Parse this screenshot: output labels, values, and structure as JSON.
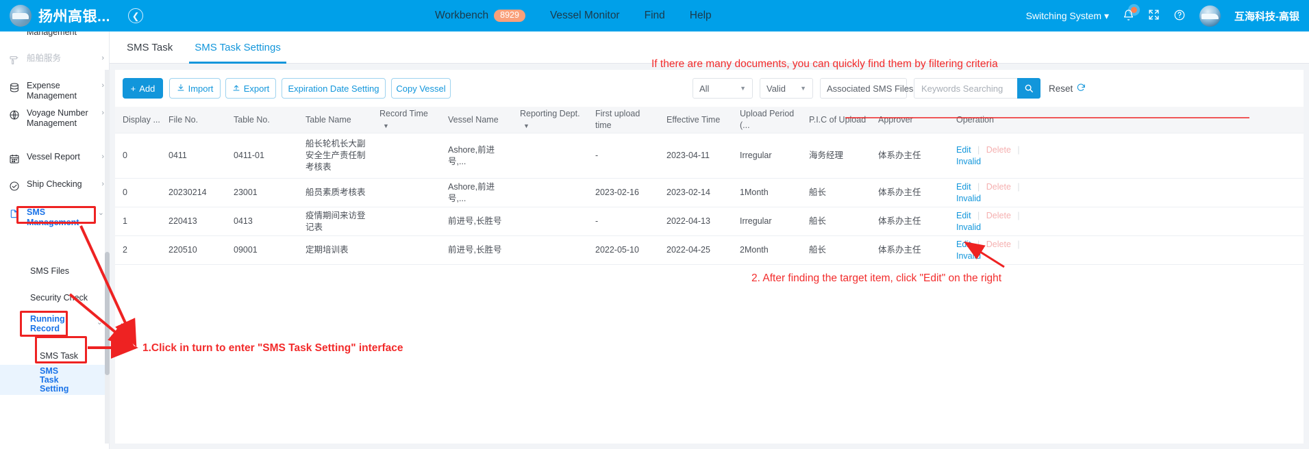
{
  "topbar": {
    "brand_title": "扬州高银...",
    "collapse_icon": "chevron-left-circle-icon",
    "nav": [
      {
        "label": "Workbench",
        "badge": "8929"
      },
      {
        "label": "Vessel Monitor",
        "badge": ""
      },
      {
        "label": "Find",
        "badge": ""
      },
      {
        "label": "Help",
        "badge": ""
      }
    ],
    "switching_system": "Switching System",
    "bell_icon": "bell-icon",
    "fullscreen_icon": "fullscreen-icon",
    "help_icon": "question-circle-icon",
    "user_name": "互海科技-高银",
    "accent": "#00a0e9"
  },
  "sidebar": {
    "items": [
      {
        "label": "Management",
        "icon": "clipped-top-item",
        "chevron": "",
        "state": "clipped"
      },
      {
        "label": "船舶服务",
        "icon": "service-icon",
        "chevron": "›",
        "state": "muted"
      },
      {
        "label": "Expense Management",
        "icon": "database-icon",
        "chevron": "›",
        "state": "normal"
      },
      {
        "label": "Voyage Number Management",
        "icon": "globe-icon",
        "chevron": "›",
        "state": "normal"
      },
      {
        "label": "Vessel Report",
        "icon": "calendar-icon",
        "chevron": "›",
        "state": "normal"
      },
      {
        "label": "Ship Checking",
        "icon": "check-circle-icon",
        "chevron": "›",
        "state": "normal"
      },
      {
        "label": "SMS Management",
        "icon": "documents-icon",
        "chevron": "⌄",
        "state": "active-boxed"
      }
    ],
    "subitems": [
      {
        "label": "SMS Files",
        "chevron": "›",
        "state": "normal"
      },
      {
        "label": "Security Check",
        "chevron": "",
        "state": "normal"
      },
      {
        "label": "Running Record",
        "chevron": "⌄",
        "state": "active-boxed"
      },
      {
        "label": "SMS Task",
        "chevron": "",
        "state": "normal"
      },
      {
        "label": "SMS Task Setting",
        "chevron": "",
        "state": "active-boxed-highlight"
      }
    ]
  },
  "tabs": [
    {
      "label": "SMS Task",
      "active": false
    },
    {
      "label": "SMS Task Settings",
      "active": true
    }
  ],
  "toolbar": {
    "add": "Add",
    "add_icon": "plus-icon",
    "import": "Import",
    "import_icon": "download-icon",
    "export": "Export",
    "export_icon": "upload-icon",
    "expiration": "Expiration Date Setting",
    "copy_vessel": "Copy Vessel"
  },
  "filters": {
    "scope": "All",
    "status": "Valid",
    "associated": "Associated SMS Files",
    "search_placeholder": "Keywords Searching",
    "search_value": "",
    "search_icon": "magnifier-icon",
    "reset": "Reset",
    "reset_icon": "refresh-icon",
    "caret": "▼"
  },
  "table": {
    "columns": [
      {
        "label": "Display ...",
        "sort": false
      },
      {
        "label": "File No.",
        "sort": false
      },
      {
        "label": "Table No.",
        "sort": false
      },
      {
        "label": "Table Name",
        "sort": false
      },
      {
        "label": "Record Time",
        "sort": true
      },
      {
        "label": "Vessel Name",
        "sort": false
      },
      {
        "label": "Reporting Dept.",
        "sort": true
      },
      {
        "label": "First upload time",
        "sort": false
      },
      {
        "label": "Effective Time",
        "sort": false
      },
      {
        "label": "Upload Period (...",
        "sort": false
      },
      {
        "label": "P.I.C of Upload",
        "sort": false
      },
      {
        "label": "Approver",
        "sort": false
      },
      {
        "label": "Operation",
        "sort": false
      }
    ],
    "rows": [
      {
        "display": "0",
        "file_no": "0411",
        "table_no": "0411-01",
        "table_name": "船长轮机长大副安全生产责任制考核表",
        "record_time": "",
        "vessel_name": "Ashore,前进号,...",
        "reporting_dept": "",
        "first_upload": "-",
        "effective_time": "2023-04-11",
        "upload_period": "Irregular",
        "pic": "海务经理",
        "approver": "体系办主任"
      },
      {
        "display": "0",
        "file_no": "20230214",
        "table_no": "23001",
        "table_name": "船员素质考核表",
        "record_time": "",
        "vessel_name": "Ashore,前进号,...",
        "reporting_dept": "",
        "first_upload": "2023-02-16",
        "effective_time": "2023-02-14",
        "upload_period": "1Month",
        "pic": "船长",
        "approver": "体系办主任"
      },
      {
        "display": "1",
        "file_no": "220413",
        "table_no": "0413",
        "table_name": "疫情期间来访登记表",
        "record_time": "",
        "vessel_name": "前进号,长胜号",
        "reporting_dept": "",
        "first_upload": "-",
        "effective_time": "2022-04-13",
        "upload_period": "Irregular",
        "pic": "船长",
        "approver": "体系办主任"
      },
      {
        "display": "2",
        "file_no": "220510",
        "table_no": "09001",
        "table_name": "定期培训表",
        "record_time": "",
        "vessel_name": "前进号,长胜号",
        "reporting_dept": "",
        "first_upload": "2022-05-10",
        "effective_time": "2022-04-25",
        "upload_period": "2Month",
        "pic": "船长",
        "approver": "体系办主任"
      }
    ],
    "operations": {
      "edit": "Edit",
      "delete": "Delete",
      "invalid": "Invalid",
      "separator": "|"
    }
  },
  "annotations": [
    {
      "id": "filter-hint",
      "text": "If there are many documents, you can quickly find them by filtering criteria"
    },
    {
      "id": "edit-hint",
      "text": "2. After finding the target item, click \"Edit\" on the right"
    },
    {
      "id": "nav-hint",
      "text": "1.Click in turn to enter \"SMS Task Setting\" interface"
    }
  ],
  "colors": {
    "annotation_red": "#f22b2b",
    "link_blue": "#1296db",
    "topbar_blue": "#00a0e9"
  }
}
